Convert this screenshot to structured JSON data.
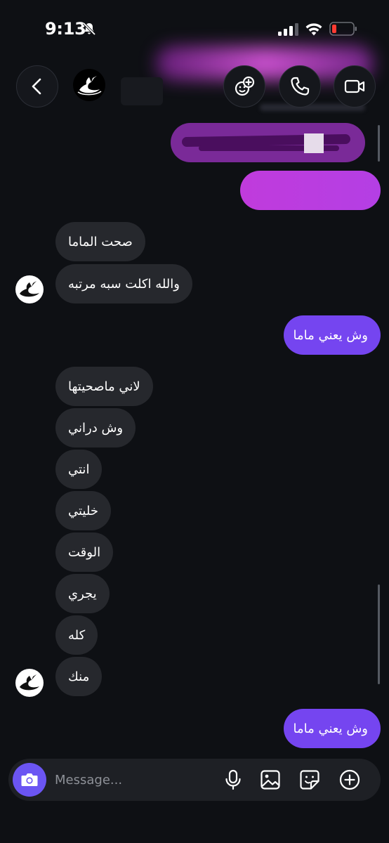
{
  "status_bar": {
    "time": "9:13"
  },
  "header": {
    "back_icon": "chevron-left-icon",
    "avatar_icon": "swan-icon",
    "actions": [
      "effects-icon",
      "phone-icon",
      "video-icon"
    ]
  },
  "colors": {
    "background": "#0e1014",
    "incoming_bubble": "#26282d",
    "outgoing_bubble": "#7545f0",
    "camera_button": "#6b55f3"
  },
  "messages": [
    {
      "dir": "in",
      "text": "صحت الماما"
    },
    {
      "dir": "in",
      "text": "والله اكلت سبه مرتبه"
    },
    {
      "dir": "out",
      "text": "وش يعني ماما"
    },
    {
      "dir": "in",
      "text": "لاني ماصحيتها"
    },
    {
      "dir": "in",
      "text": "وش دراني"
    },
    {
      "dir": "in",
      "text": "انتي"
    },
    {
      "dir": "in",
      "text": "خليتي"
    },
    {
      "dir": "in",
      "text": "الوقت"
    },
    {
      "dir": "in",
      "text": "يجري"
    },
    {
      "dir": "in",
      "text": "كله"
    },
    {
      "dir": "in",
      "text": "منك"
    },
    {
      "dir": "out",
      "text": "وش يعني ماما"
    }
  ],
  "composer": {
    "placeholder": "Message...",
    "icons": [
      "camera-icon",
      "microphone-icon",
      "gallery-icon",
      "sticker-icon",
      "plus-icon"
    ]
  }
}
